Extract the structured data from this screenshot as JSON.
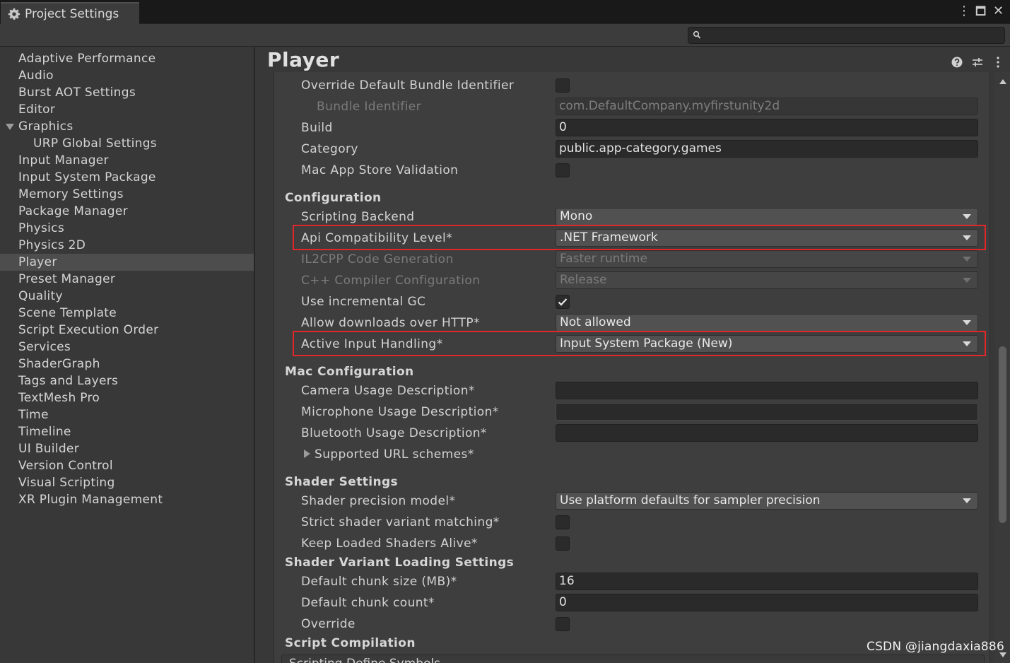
{
  "window": {
    "tab_title": "Project Settings",
    "controls": {
      "more": "⋮",
      "maximize": "🗖",
      "close": "✕"
    }
  },
  "search": {
    "placeholder": "",
    "value": ""
  },
  "sidebar": {
    "items": [
      {
        "label": "Adaptive Performance"
      },
      {
        "label": "Audio"
      },
      {
        "label": "Burst AOT Settings"
      },
      {
        "label": "Editor"
      },
      {
        "label": "Graphics",
        "expanded": true
      },
      {
        "label": "URP Global Settings",
        "child": true
      },
      {
        "label": "Input Manager"
      },
      {
        "label": "Input System Package"
      },
      {
        "label": "Memory Settings"
      },
      {
        "label": "Package Manager"
      },
      {
        "label": "Physics"
      },
      {
        "label": "Physics 2D"
      },
      {
        "label": "Player",
        "selected": true
      },
      {
        "label": "Preset Manager"
      },
      {
        "label": "Quality"
      },
      {
        "label": "Scene Template"
      },
      {
        "label": "Script Execution Order"
      },
      {
        "label": "Services"
      },
      {
        "label": "ShaderGraph"
      },
      {
        "label": "Tags and Layers"
      },
      {
        "label": "TextMesh Pro"
      },
      {
        "label": "Time"
      },
      {
        "label": "Timeline"
      },
      {
        "label": "UI Builder"
      },
      {
        "label": "Version Control"
      },
      {
        "label": "Visual Scripting"
      },
      {
        "label": "XR Plugin Management"
      }
    ]
  },
  "main": {
    "title": "Player",
    "header_icons": [
      "help-icon",
      "preset-icon",
      "more-icon"
    ],
    "identification": {
      "override_bundle": {
        "label": "Override Default Bundle Identifier",
        "checked": false
      },
      "bundle_identifier": {
        "label": "Bundle Identifier",
        "value": "com.DefaultCompany.myfirstunity2d"
      },
      "build": {
        "label": "Build",
        "value": "0"
      },
      "category": {
        "label": "Category",
        "value": "public.app-category.games"
      },
      "mac_validation": {
        "label": "Mac App Store Validation",
        "checked": false
      }
    },
    "configuration": {
      "header": "Configuration",
      "scripting_backend": {
        "label": "Scripting Backend",
        "value": "Mono"
      },
      "api_level": {
        "label": "Api Compatibility Level*",
        "value": ".NET Framework"
      },
      "il2cpp_codegen": {
        "label": "IL2CPP Code Generation",
        "value": "Faster runtime"
      },
      "cpp_compiler": {
        "label": "C++ Compiler Configuration",
        "value": "Release"
      },
      "incremental_gc": {
        "label": "Use incremental GC",
        "checked": true
      },
      "allow_http": {
        "label": "Allow downloads over HTTP*",
        "value": "Not allowed"
      },
      "active_input": {
        "label": "Active Input Handling*",
        "value": "Input System Package (New)"
      }
    },
    "mac_configuration": {
      "header": "Mac Configuration",
      "camera": {
        "label": "Camera Usage Description*",
        "value": ""
      },
      "microphone": {
        "label": "Microphone Usage Description*",
        "value": ""
      },
      "bluetooth": {
        "label": "Bluetooth Usage Description*",
        "value": ""
      },
      "url_schemes": {
        "label": "Supported URL schemes*"
      }
    },
    "shader_settings": {
      "header": "Shader Settings",
      "precision": {
        "label": "Shader precision model*",
        "value": "Use platform defaults for sampler precision"
      },
      "strict_matching": {
        "label": "Strict shader variant matching*",
        "checked": false
      },
      "keep_loaded": {
        "label": "Keep Loaded Shaders Alive*",
        "checked": false
      }
    },
    "shader_variant_loading": {
      "header": "Shader Variant Loading Settings",
      "chunk_size": {
        "label": "Default chunk size (MB)*",
        "value": "16"
      },
      "chunk_count": {
        "label": "Default chunk count*",
        "value": "0"
      },
      "override": {
        "label": "Override",
        "checked": false
      }
    },
    "script_compilation": {
      "header": "Script Compilation",
      "define_symbols": "Scripting Define Symbols"
    }
  },
  "highlight_color": "#e0282a",
  "watermark": "CSDN @jiangdaxia886"
}
